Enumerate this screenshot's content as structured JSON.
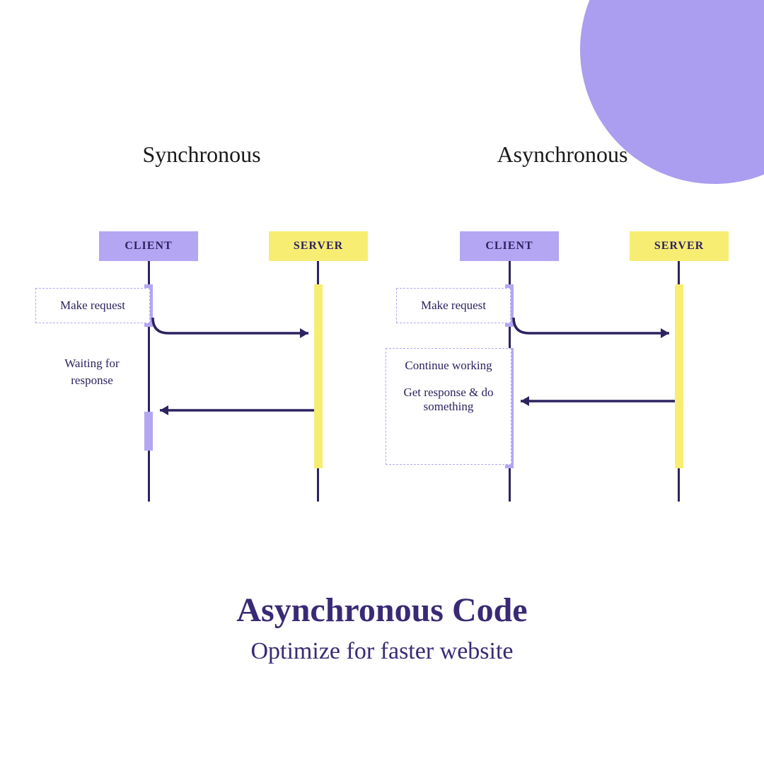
{
  "sync": {
    "title": "Synchronous",
    "clientLabel": "CLIENT",
    "serverLabel": "SERVER",
    "makeRequest": "Make request",
    "waiting": "Waiting for response"
  },
  "async": {
    "title": "Asynchronous",
    "clientLabel": "CLIENT",
    "serverLabel": "SERVER",
    "makeRequest": "Make request",
    "continueWorking": "Continue working",
    "getResponse": "Get response & do something"
  },
  "footer": {
    "title": "Asynchronous Code",
    "subtitle": "Optimize for faster website"
  },
  "colors": {
    "purple": "#b4a6f3",
    "yellow": "#f8ed73",
    "dark": "#2e2260",
    "deepPurple": "#3a2a75"
  }
}
